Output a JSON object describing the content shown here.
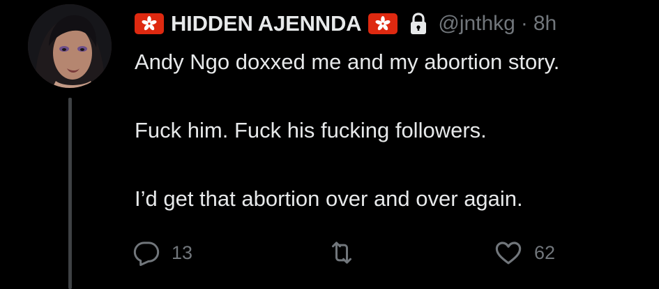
{
  "author": {
    "display_name": "HIDDEN AJENNDA",
    "handle": "@jnthkg",
    "separator": "·",
    "time": "8h",
    "flag_icon": "hong-kong-flag-icon",
    "lock_icon": "lock-icon"
  },
  "tweet": {
    "lines": [
      "Andy Ngo doxxed me and my abortion story.",
      "",
      "Fuck him. Fuck his fucking followers.",
      "",
      "I’d get that abortion over and over again."
    ]
  },
  "actions": {
    "reply_count": "13",
    "retweet_count": "",
    "like_count": "62",
    "icons": [
      "reply-icon",
      "retweet-icon",
      "like-icon"
    ]
  },
  "colors": {
    "background": "#000000",
    "text": "#e7e9ea",
    "muted": "#71767b",
    "flag_red": "#de2910",
    "thread_line": "#3e4144"
  }
}
